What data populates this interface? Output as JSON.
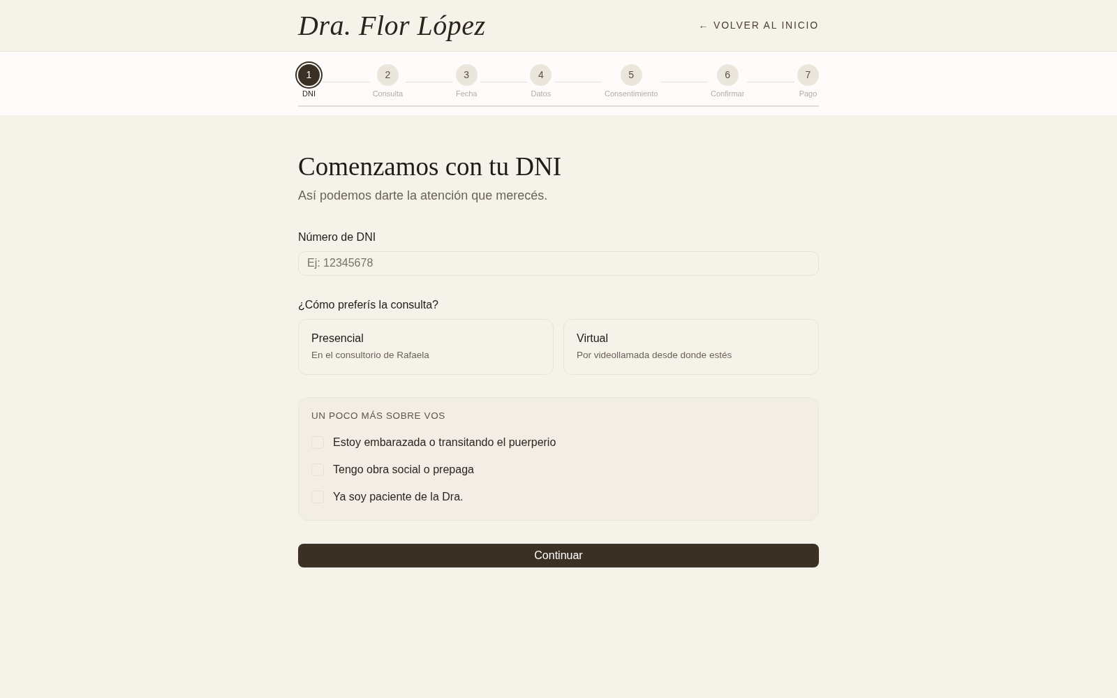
{
  "header": {
    "logo": "Dra. Flor López",
    "back_link": "← VOLVER AL INICIO"
  },
  "steps": [
    {
      "number": "1",
      "label": "DNI",
      "selected": true
    },
    {
      "number": "2",
      "label": "Consulta",
      "selected": false
    },
    {
      "number": "3",
      "label": "Fecha",
      "selected": false
    },
    {
      "number": "4",
      "label": "Datos",
      "selected": false
    },
    {
      "number": "5",
      "label": "Consentimiento",
      "selected": false
    },
    {
      "number": "6",
      "label": "Confirmar",
      "selected": false
    },
    {
      "number": "7",
      "label": "Pago",
      "selected": false
    }
  ],
  "page": {
    "title": "Comenzamos con tu DNI",
    "subtitle": "Así podemos darte la atención que merecés."
  },
  "dni_field": {
    "label": "Número de DNI",
    "placeholder": "Ej: 12345678"
  },
  "consultation": {
    "question": "¿Cómo preferís la consulta?",
    "options": [
      {
        "title": "Presencial",
        "description": "En el consultorio de Rafaela",
        "selected": false
      },
      {
        "title": "Virtual",
        "description": "Por videollamada desde donde estés",
        "selected": false
      }
    ]
  },
  "about": {
    "heading": "UN POCO MÁS SOBRE VOS",
    "options": [
      {
        "label": "Estoy embarazada o transitando el puerperio",
        "checked": false
      },
      {
        "label": "Tengo obra social o prepaga",
        "checked": false
      },
      {
        "label": "Ya soy paciente de la Dra.",
        "checked": false
      }
    ]
  },
  "continue_button": "Continuar"
}
